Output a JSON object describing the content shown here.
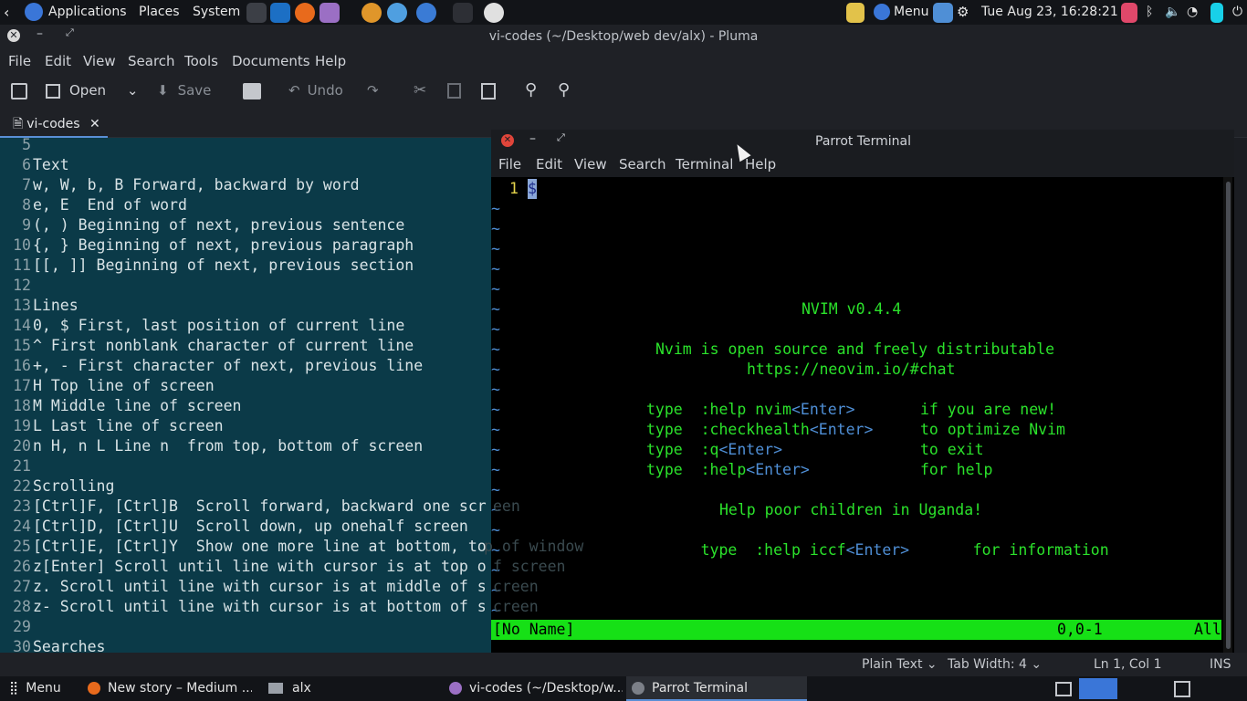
{
  "top_panel": {
    "applications": "Applications",
    "places": "Places",
    "system": "System",
    "menu": "Menu",
    "clock": "Tue Aug 23, 16:28:21",
    "colors": {
      "bg": "#121418",
      "accent": "#3a76d8"
    }
  },
  "pluma": {
    "title": "vi-codes (~/Desktop/web dev/alx) - Pluma",
    "menu": [
      "File",
      "Edit",
      "View",
      "Search",
      "Tools",
      "Documents",
      "Help"
    ],
    "toolbar": {
      "open": "Open",
      "save": "Save",
      "undo": "Undo"
    },
    "tab": "vi-codes",
    "lines": [
      {
        "n": "5",
        "t": ""
      },
      {
        "n": "6",
        "t": "Text"
      },
      {
        "n": "7",
        "t": "w, W, b, B Forward, backward by word"
      },
      {
        "n": "8",
        "t": "e, E  End of word"
      },
      {
        "n": "9",
        "t": "(, ) Beginning of next, previous sentence"
      },
      {
        "n": "10",
        "t": "{, } Beginning of next, previous paragraph"
      },
      {
        "n": "11",
        "t": "[[, ]] Beginning of next, previous section"
      },
      {
        "n": "12",
        "t": ""
      },
      {
        "n": "13",
        "t": "Lines"
      },
      {
        "n": "14",
        "t": "0, $ First, last position of current line"
      },
      {
        "n": "15",
        "t": "^ First nonblank character of current line"
      },
      {
        "n": "16",
        "t": "+, - First character of next, previous line"
      },
      {
        "n": "17",
        "t": "H Top line of screen"
      },
      {
        "n": "18",
        "t": "M Middle line of screen"
      },
      {
        "n": "19",
        "t": "L Last line of screen"
      },
      {
        "n": "20",
        "t": "n H, n L Line n  from top, bottom of screen"
      },
      {
        "n": "21",
        "t": ""
      },
      {
        "n": "22",
        "t": "Scrolling"
      },
      {
        "n": "23",
        "t": "[Ctrl]F, [Ctrl]B  Scroll forward, backward one scr"
      },
      {
        "n": "24",
        "t": "[Ctrl]D, [Ctrl]U  Scroll down, up onehalf screen"
      },
      {
        "n": "25",
        "t": "[Ctrl]E, [Ctrl]Y  Show one more line at bottom, to"
      },
      {
        "n": "26",
        "t": "z[Enter] Scroll until line with cursor is at top o"
      },
      {
        "n": "27",
        "t": "z. Scroll until line with cursor is at middle of s"
      },
      {
        "n": "28",
        "t": "z- Scroll until line with cursor is at bottom of s"
      },
      {
        "n": "29",
        "t": ""
      },
      {
        "n": "30",
        "t": "Searches"
      }
    ],
    "overflow": [
      {
        "row": 18,
        "t": "een"
      },
      {
        "row": 20,
        "t": "p of window"
      },
      {
        "row": 21,
        "t": "f screen"
      },
      {
        "row": 22,
        "t": "creen"
      },
      {
        "row": 23,
        "t": "creen"
      }
    ],
    "status": {
      "lang": "Plain Text",
      "tab_width": "Tab Width: 4",
      "position": "Ln 1, Col 1",
      "mode": "INS"
    }
  },
  "terminal": {
    "title": "Parrot Terminal",
    "menu": [
      "File",
      "Edit",
      "View",
      "Search",
      "Terminal",
      "Help"
    ],
    "line_number": "1",
    "cursor_char": "$",
    "tilde": "~",
    "intro": {
      "version": "NVIM v0.4.4",
      "line1": "Nvim is open source and freely distributable",
      "line2": "https://neovim.io/#chat",
      "cmds": [
        {
          "type": "type",
          "cmd": ":help nvim",
          "key": "<Enter>",
          "desc": "if you are new!"
        },
        {
          "type": "type",
          "cmd": ":checkhealth",
          "key": "<Enter>",
          "desc": "to optimize Nvim"
        },
        {
          "type": "type",
          "cmd": ":q",
          "key": "<Enter>",
          "desc": "to exit"
        },
        {
          "type": "type",
          "cmd": ":help",
          "key": "<Enter>",
          "desc": "for help"
        }
      ],
      "uganda": "Help poor children in Uganda!",
      "iccf": {
        "type": "type",
        "cmd": ":help iccf",
        "key": "<Enter>",
        "desc": "for information"
      }
    },
    "statusline": {
      "name": "[No Name]",
      "pos": "0,0-1",
      "scroll": "All"
    },
    "colors": {
      "text": "#2be22b",
      "statusline": "#16e016",
      "tilde": "#4f8fd6",
      "key": "#4f8fd6"
    }
  },
  "taskbar": {
    "menu": "Menu",
    "tasks": [
      "New story – Medium ...",
      "alx",
      "vi-codes (~/Desktop/w...",
      "Parrot Terminal"
    ]
  }
}
